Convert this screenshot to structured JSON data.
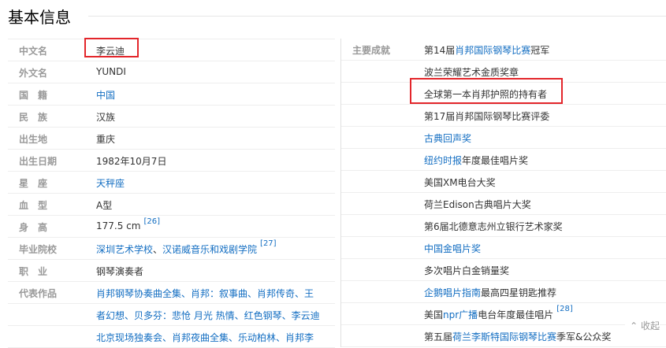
{
  "section": {
    "title": "基本信息"
  },
  "left_rows": [
    {
      "label": "中文名",
      "value": "李云迪"
    },
    {
      "label": "外文名",
      "value": "YUNDI"
    },
    {
      "label": "国　籍",
      "link": "中国"
    },
    {
      "label": "民　族",
      "value": "汉族"
    },
    {
      "label": "出生地",
      "value": "重庆"
    },
    {
      "label": "出生日期",
      "value": "1982年10月7日"
    },
    {
      "label": "星　座",
      "link": "天秤座"
    },
    {
      "label": "血　型",
      "value": "A型"
    },
    {
      "label": "身　高",
      "value": "177.5 cm",
      "ref": "[26]"
    },
    {
      "label": "毕业院校",
      "link1": "深圳艺术学校",
      "sep": "、",
      "link2": "汉诺威音乐和戏剧学院",
      "ref": "[27]"
    },
    {
      "label": "职　业",
      "value": "钢琴演奏者"
    },
    {
      "label": "代表作品",
      "text": "肖邦钢琴协奏曲全集、肖邦：叙事曲、肖邦传奇、王"
    },
    {
      "label": "",
      "text": "者幻想、贝多芬：悲怆 月光 热情、红色钢琴、李云迪"
    },
    {
      "label": "",
      "text": "北京现场独奏会、肖邦夜曲全集、乐动柏林、肖邦李"
    }
  ],
  "right_rows": [
    {
      "label": "主要成就",
      "pre": "第14届",
      "link": "肖邦国际钢琴比赛",
      "post": "冠军"
    },
    {
      "label": "",
      "pre": "波兰荣耀艺术金质奖章"
    },
    {
      "label": "",
      "pre": "全球第一本肖邦护照的持有者"
    },
    {
      "label": "",
      "pre": "第17届肖邦国际钢琴比赛评委"
    },
    {
      "label": "",
      "link": "古典回声奖"
    },
    {
      "label": "",
      "link": "纽约时报",
      "post": "年度最佳唱片奖"
    },
    {
      "label": "",
      "pre": "美国XM电台大奖"
    },
    {
      "label": "",
      "pre": "荷兰Edison古典唱片大奖"
    },
    {
      "label": "",
      "pre": "第6届北德意志州立银行艺术家奖"
    },
    {
      "label": "",
      "link": "中国金唱片奖"
    },
    {
      "label": "",
      "pre": "多次唱片白金销量奖"
    },
    {
      "label": "",
      "link": "企鹅唱片指南",
      "post": "最高四星钥匙推荐"
    },
    {
      "label": "",
      "pre": "美国",
      "link": "npr广播",
      "post": "电台年度最佳唱片",
      "ref": "[28]"
    },
    {
      "label": "",
      "pre": "第五届",
      "link": "荷兰李斯特国际钢琴比赛",
      "post": "季军&公众奖"
    }
  ],
  "collapse_label": "收起",
  "colors": {
    "link": "#136ec2",
    "highlight": "#e3262b"
  }
}
